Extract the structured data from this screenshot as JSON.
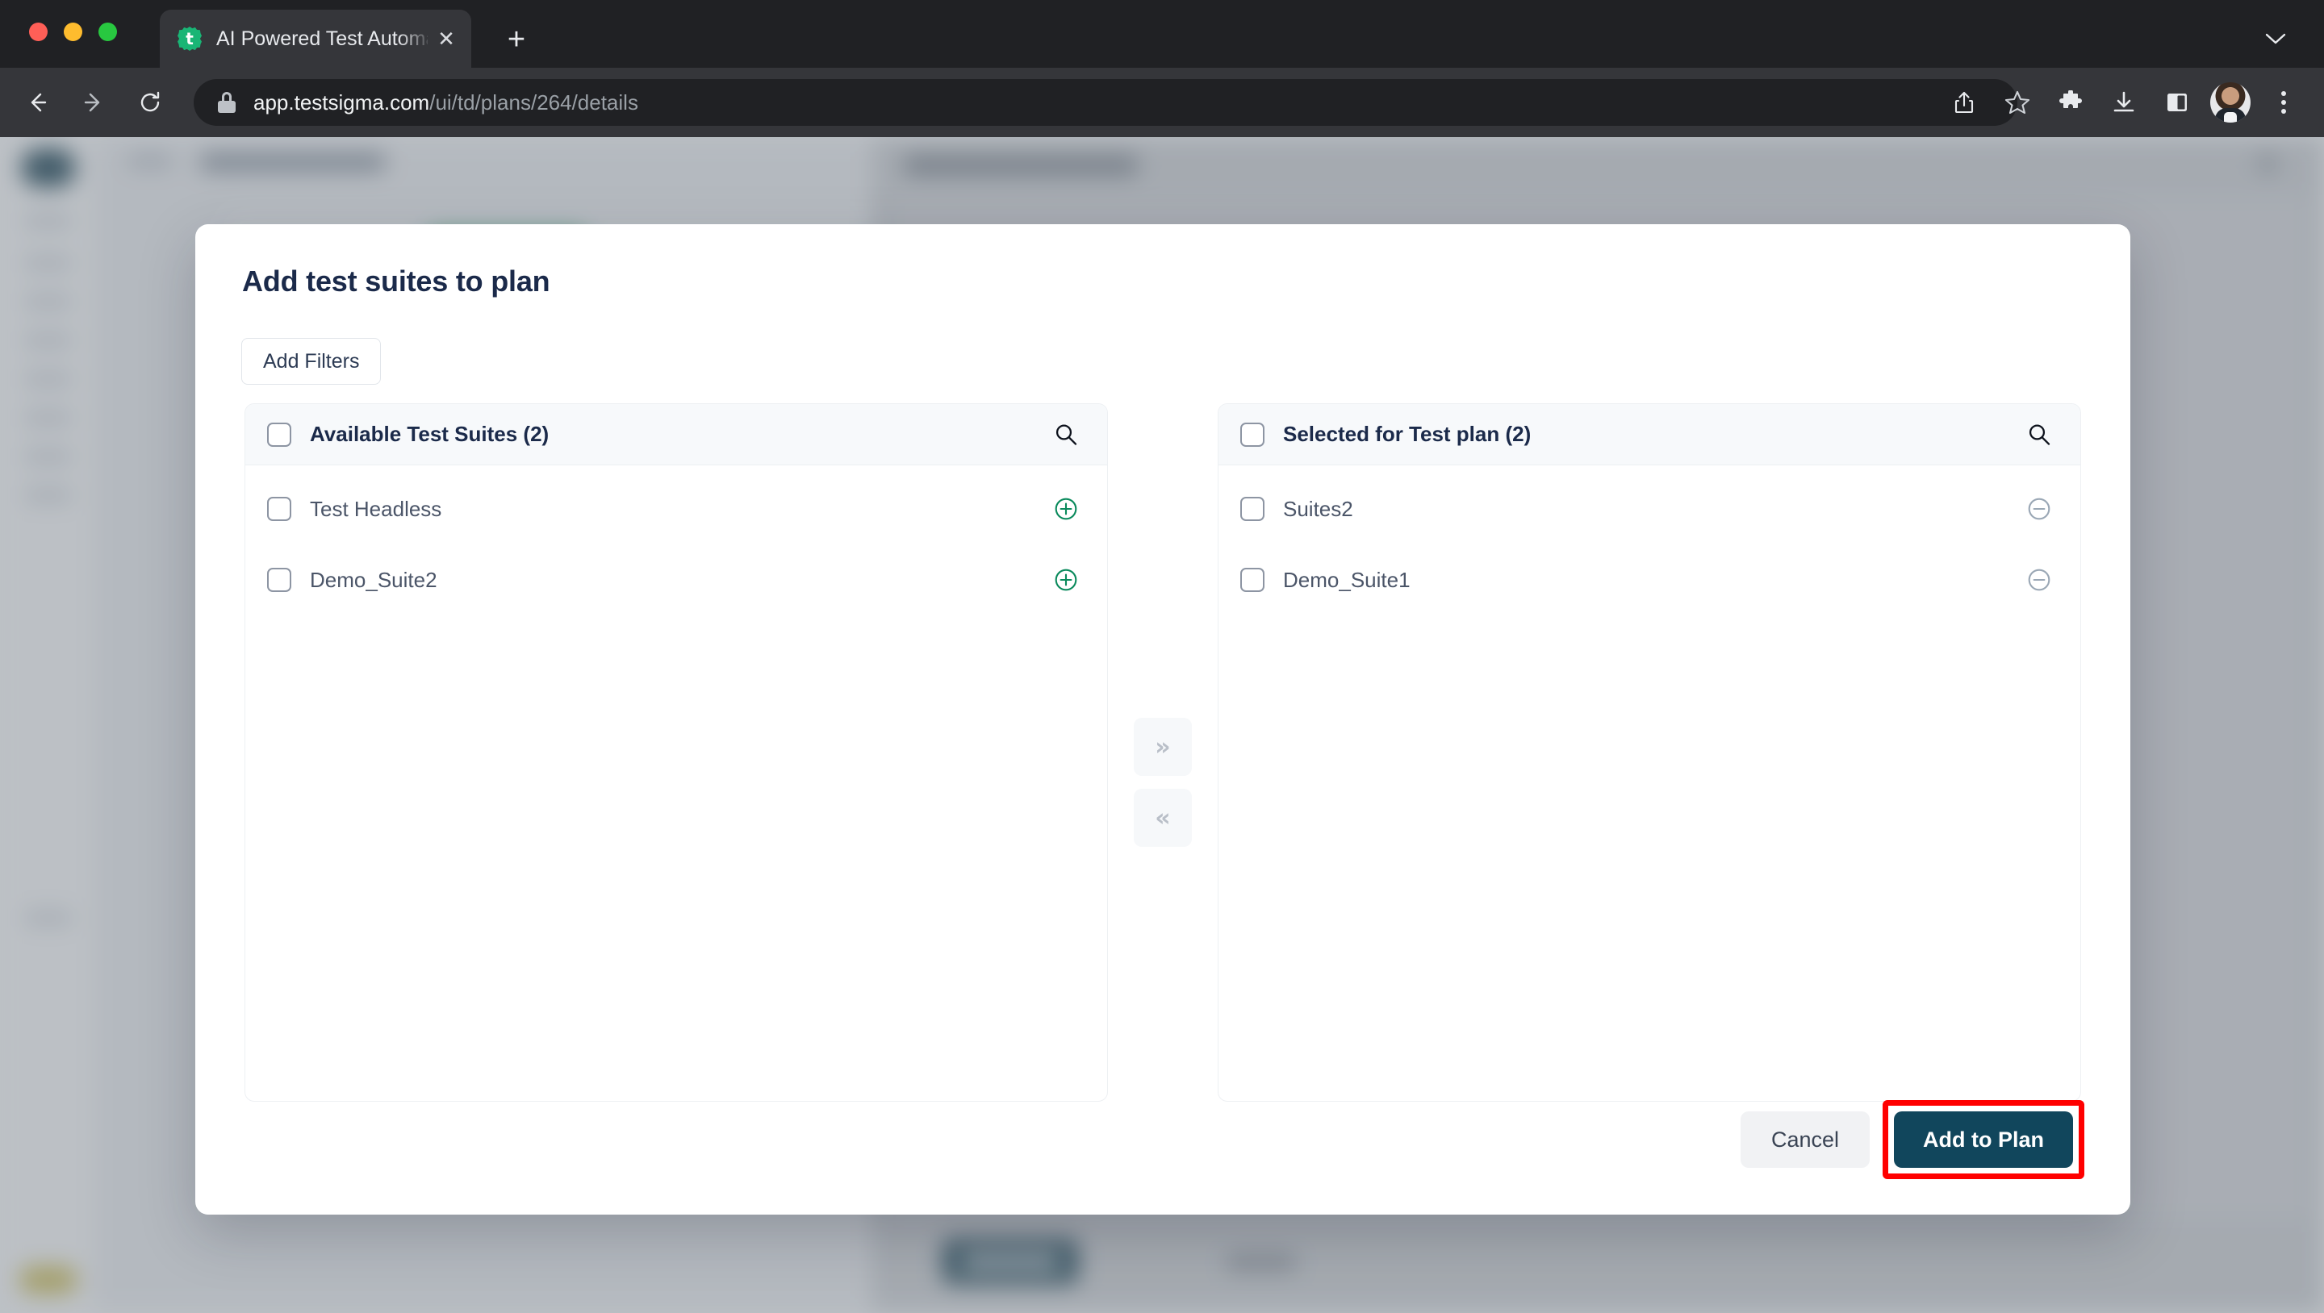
{
  "browser": {
    "tab": {
      "title": "AI Powered Test Automation Pl",
      "favicon": "testsigma-gear-icon",
      "close_label": "✕"
    },
    "new_tab_label": "+",
    "tabstrip_chevron": "⌄",
    "url": {
      "domain": "app.testsigma.com",
      "path": "/ui/td/plans/264/details"
    },
    "icons": {
      "back": "back-arrow-icon",
      "forward": "forward-arrow-icon",
      "reload": "reload-icon",
      "lock": "lock-icon",
      "share": "share-icon",
      "bookmark": "star-icon",
      "extensions": "puzzle-icon",
      "downloads": "download-icon",
      "side_panel": "side-panel-icon",
      "profile": "avatar-icon",
      "menu": "kebab-menu-icon"
    }
  },
  "modal": {
    "title": "Add test suites to plan",
    "add_filters_label": "Add Filters",
    "available": {
      "header": "Available Test Suites (2)",
      "search_icon": "search-icon",
      "items": [
        {
          "label": "Test Headless",
          "action": "add"
        },
        {
          "label": "Demo_Suite2",
          "action": "add"
        }
      ]
    },
    "selected": {
      "header": "Selected for Test plan (2)",
      "search_icon": "search-icon",
      "items": [
        {
          "label": "Suites2",
          "action": "remove"
        },
        {
          "label": "Demo_Suite1",
          "action": "remove"
        }
      ]
    },
    "transfer": {
      "move_right_label": "»",
      "move_left_label": "«"
    },
    "footer": {
      "cancel_label": "Cancel",
      "primary_label": "Add to Plan"
    }
  },
  "colors": {
    "accent_dark": "#11465c",
    "title_navy": "#1b2a4a",
    "add_green": "#0a8a5c",
    "remove_grey": "#9aa7b5",
    "highlight_red": "#ff0000",
    "panel_header_bg": "#f7f9fb"
  }
}
